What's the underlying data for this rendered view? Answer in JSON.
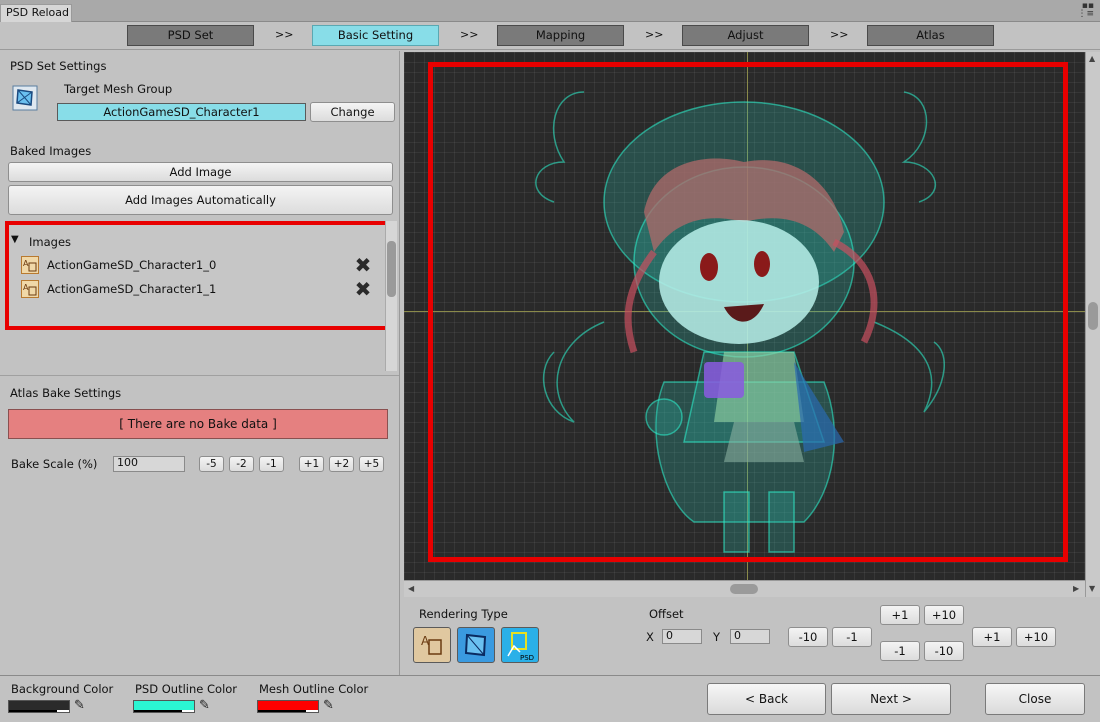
{
  "window": {
    "title": "PSD Reload"
  },
  "steps": [
    {
      "label": "PSD Set"
    },
    {
      "label": "Basic Setting"
    },
    {
      "label": "Mapping"
    },
    {
      "label": "Adjust"
    },
    {
      "label": "Atlas"
    }
  ],
  "step_separator": ">>",
  "psd_set": {
    "heading": "PSD Set Settings",
    "target_mesh_group_label": "Target Mesh Group",
    "target_mesh_group_value": "ActionGameSD_Character1",
    "change_button": "Change"
  },
  "baked_images": {
    "heading": "Baked Images",
    "add_image_button": "Add Image",
    "add_auto_button": "Add Images Automatically",
    "list_title": "Images",
    "items": [
      {
        "name": "ActionGameSD_Character1_0"
      },
      {
        "name": "ActionGameSD_Character1_1"
      }
    ]
  },
  "atlas_bake": {
    "heading": "Atlas Bake Settings",
    "no_data_text": "[ There are no Bake data ]",
    "bake_scale_label": "Bake Scale (%)",
    "bake_scale_value": "100",
    "scale_buttons": [
      "-5",
      "-2",
      "-1",
      "+1",
      "+2",
      "+5"
    ]
  },
  "rendering": {
    "label": "Rendering Type",
    "offset_label": "Offset",
    "x_label": "X",
    "x_value": "0",
    "y_label": "Y",
    "y_value": "0",
    "x_minus10": "-10",
    "x_minus1": "-1",
    "y_plus1": "+1",
    "y_plus10": "+10",
    "y_minus1": "-1",
    "y_minus10": "-10",
    "x_plus1": "+1",
    "x_plus10": "+10",
    "psd_icon_text": "PSD"
  },
  "footer": {
    "background_color_label": "Background Color",
    "psd_outline_label": "PSD Outline Color",
    "mesh_outline_label": "Mesh Outline Color",
    "back_button": "< Back",
    "next_button": "Next >",
    "close_button": "Close"
  },
  "colors": {
    "background": "#2b2b2b",
    "psd_outline": "#2bf5d2",
    "mesh_outline": "#ff0000",
    "active_step": "#88dde8"
  }
}
